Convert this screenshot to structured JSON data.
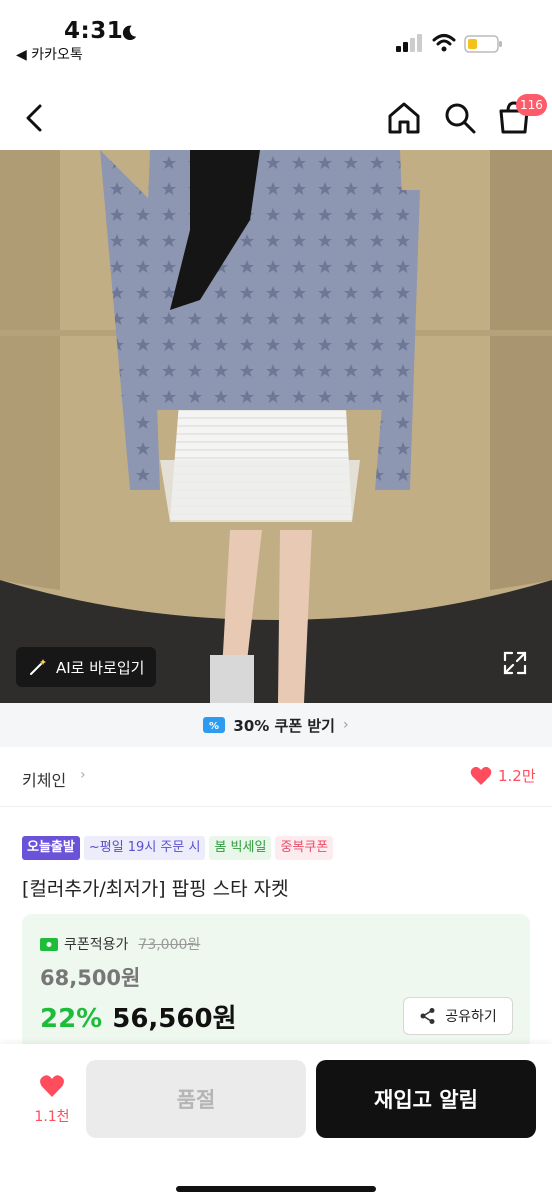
{
  "status_bar": {
    "time": "4:31",
    "back_app": "◀ 카카오톡"
  },
  "navbar": {
    "cart_count": "116"
  },
  "hero": {
    "ai_button_label": "AI로 바로입기"
  },
  "coupon_strip": {
    "label": "30% 쿠폰 받기",
    "chevron": "›"
  },
  "brand": {
    "name": "키체인",
    "chevron": "›",
    "like_count": "1.2만"
  },
  "tags": [
    "오늘출발",
    "~평일 19시 주문 시",
    "봄 빅세일",
    "중복쿠폰"
  ],
  "product": {
    "title": "[컬러추가/최저가] 팝핑 스타 자켓"
  },
  "price": {
    "coupon_label": "쿠폰적용가",
    "list_price": "73,000원",
    "original_price": "68,500원",
    "discount": "22%",
    "sale_price": "56,560원",
    "share_label": "공유하기"
  },
  "bottom_bar": {
    "wish_count": "1.1천",
    "soldout_label": "품절",
    "restock_label": "재입고 알림"
  },
  "colors": {
    "accent_green": "#1fbb3b",
    "like_red": "#ff4d5e",
    "badge_red": "#ff5a6a",
    "tag_purple": "#6a52d9"
  },
  "icons": [
    "moon-icon",
    "signal-icon",
    "wifi-icon",
    "battery-icon",
    "back-arrow-icon",
    "home-icon",
    "search-icon",
    "cart-icon",
    "magic-wand-icon",
    "expand-icon",
    "coupon-ticket-icon",
    "heart-icon",
    "share-icon"
  ]
}
